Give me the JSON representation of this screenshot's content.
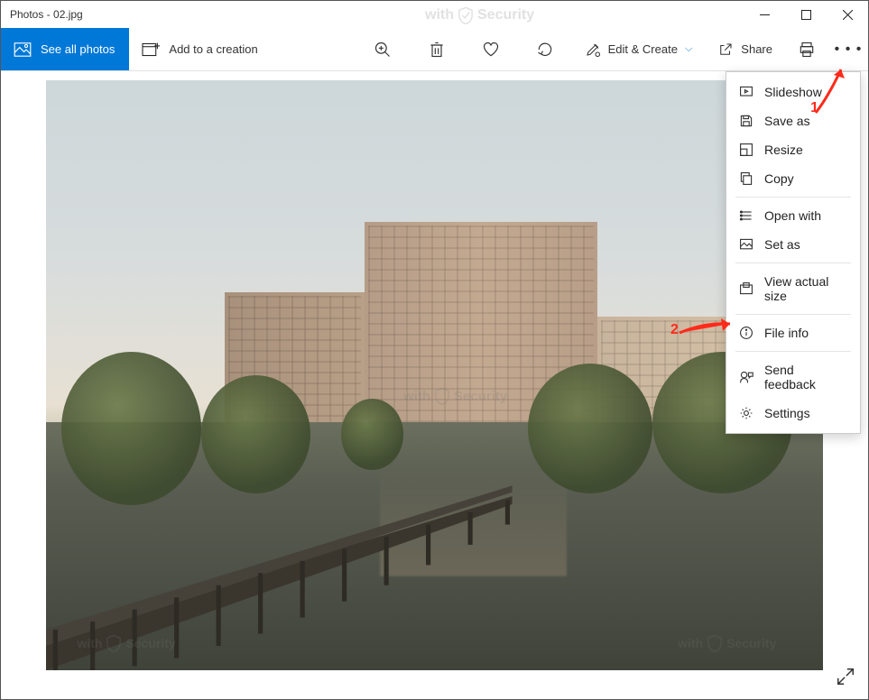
{
  "title": "Photos - 02.jpg",
  "watermark_text": "withSecurity",
  "toolbar": {
    "see_all_photos": "See all photos",
    "add_to_creation": "Add to a creation",
    "edit_create": "Edit & Create",
    "share": "Share"
  },
  "dropdown": {
    "slideshow": "Slideshow",
    "save_as": "Save as",
    "resize": "Resize",
    "copy": "Copy",
    "open_with": "Open with",
    "set_as": "Set as",
    "view_actual_size": "View actual size",
    "file_info": "File info",
    "send_feedback": "Send feedback",
    "settings": "Settings"
  },
  "annotations": {
    "step1": "1",
    "step2": "2"
  }
}
